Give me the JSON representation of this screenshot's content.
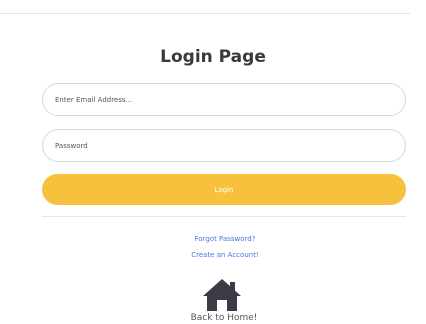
{
  "header": {
    "title": "Login Page"
  },
  "form": {
    "email_placeholder": "Enter Email Address...",
    "password_placeholder": "Password",
    "login_label": "Login"
  },
  "links": {
    "forgot_password": "Forgot Password?",
    "create_account": "Create an Account!",
    "back_home": "Back to Home!"
  },
  "icons": {
    "home": "home-icon"
  },
  "colors": {
    "accent": "#f6c23e",
    "link": "#4e73df",
    "icon": "#3a3b45"
  }
}
